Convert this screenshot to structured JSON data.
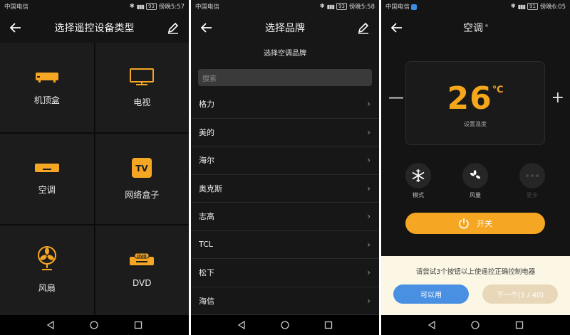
{
  "accent_color": "#f5a623",
  "left": {
    "status": {
      "carrier": "中国电信",
      "battery": "93",
      "time": "傍晚5:57"
    },
    "title": "选择遥控设备类型",
    "devices": [
      {
        "label": "机顶盒",
        "icon": "set-top-box-icon"
      },
      {
        "label": "电视",
        "icon": "tv-icon"
      },
      {
        "label": "空调",
        "icon": "air-conditioner-icon"
      },
      {
        "label": "网络盒子",
        "icon": "network-box-icon",
        "badge": "TV"
      },
      {
        "label": "风扇",
        "icon": "fan-icon"
      },
      {
        "label": "DVD",
        "icon": "dvd-icon",
        "badge": "DVD"
      }
    ]
  },
  "middle": {
    "status": {
      "carrier": "中国电信",
      "battery": "93",
      "time": "傍晚5:58"
    },
    "title": "选择品牌",
    "subtitle": "选择空调品牌",
    "search_placeholder": "搜索",
    "brands": [
      "格力",
      "美的",
      "海尔",
      "奥克斯",
      "志高",
      "TCL",
      "松下",
      "海信"
    ]
  },
  "right": {
    "status": {
      "carrier": "中国电信",
      "battery": "91",
      "time": "傍晚6:05"
    },
    "title": "空调",
    "minus": "—",
    "plus": "+",
    "temperature": "26",
    "temperature_unit": "℃",
    "temperature_caption": "设置温度",
    "modes": [
      {
        "label": "模式",
        "icon": "snowflake-icon"
      },
      {
        "label": "风量",
        "icon": "fan-speed-icon"
      },
      {
        "label": "更多",
        "icon": "more-icon"
      }
    ],
    "power_label": "开关",
    "prompt": "请尝试3个按钮以上使遥控正确控制电器",
    "confirm_label": "可以用",
    "next_label": "下一个(1 / 40)"
  }
}
